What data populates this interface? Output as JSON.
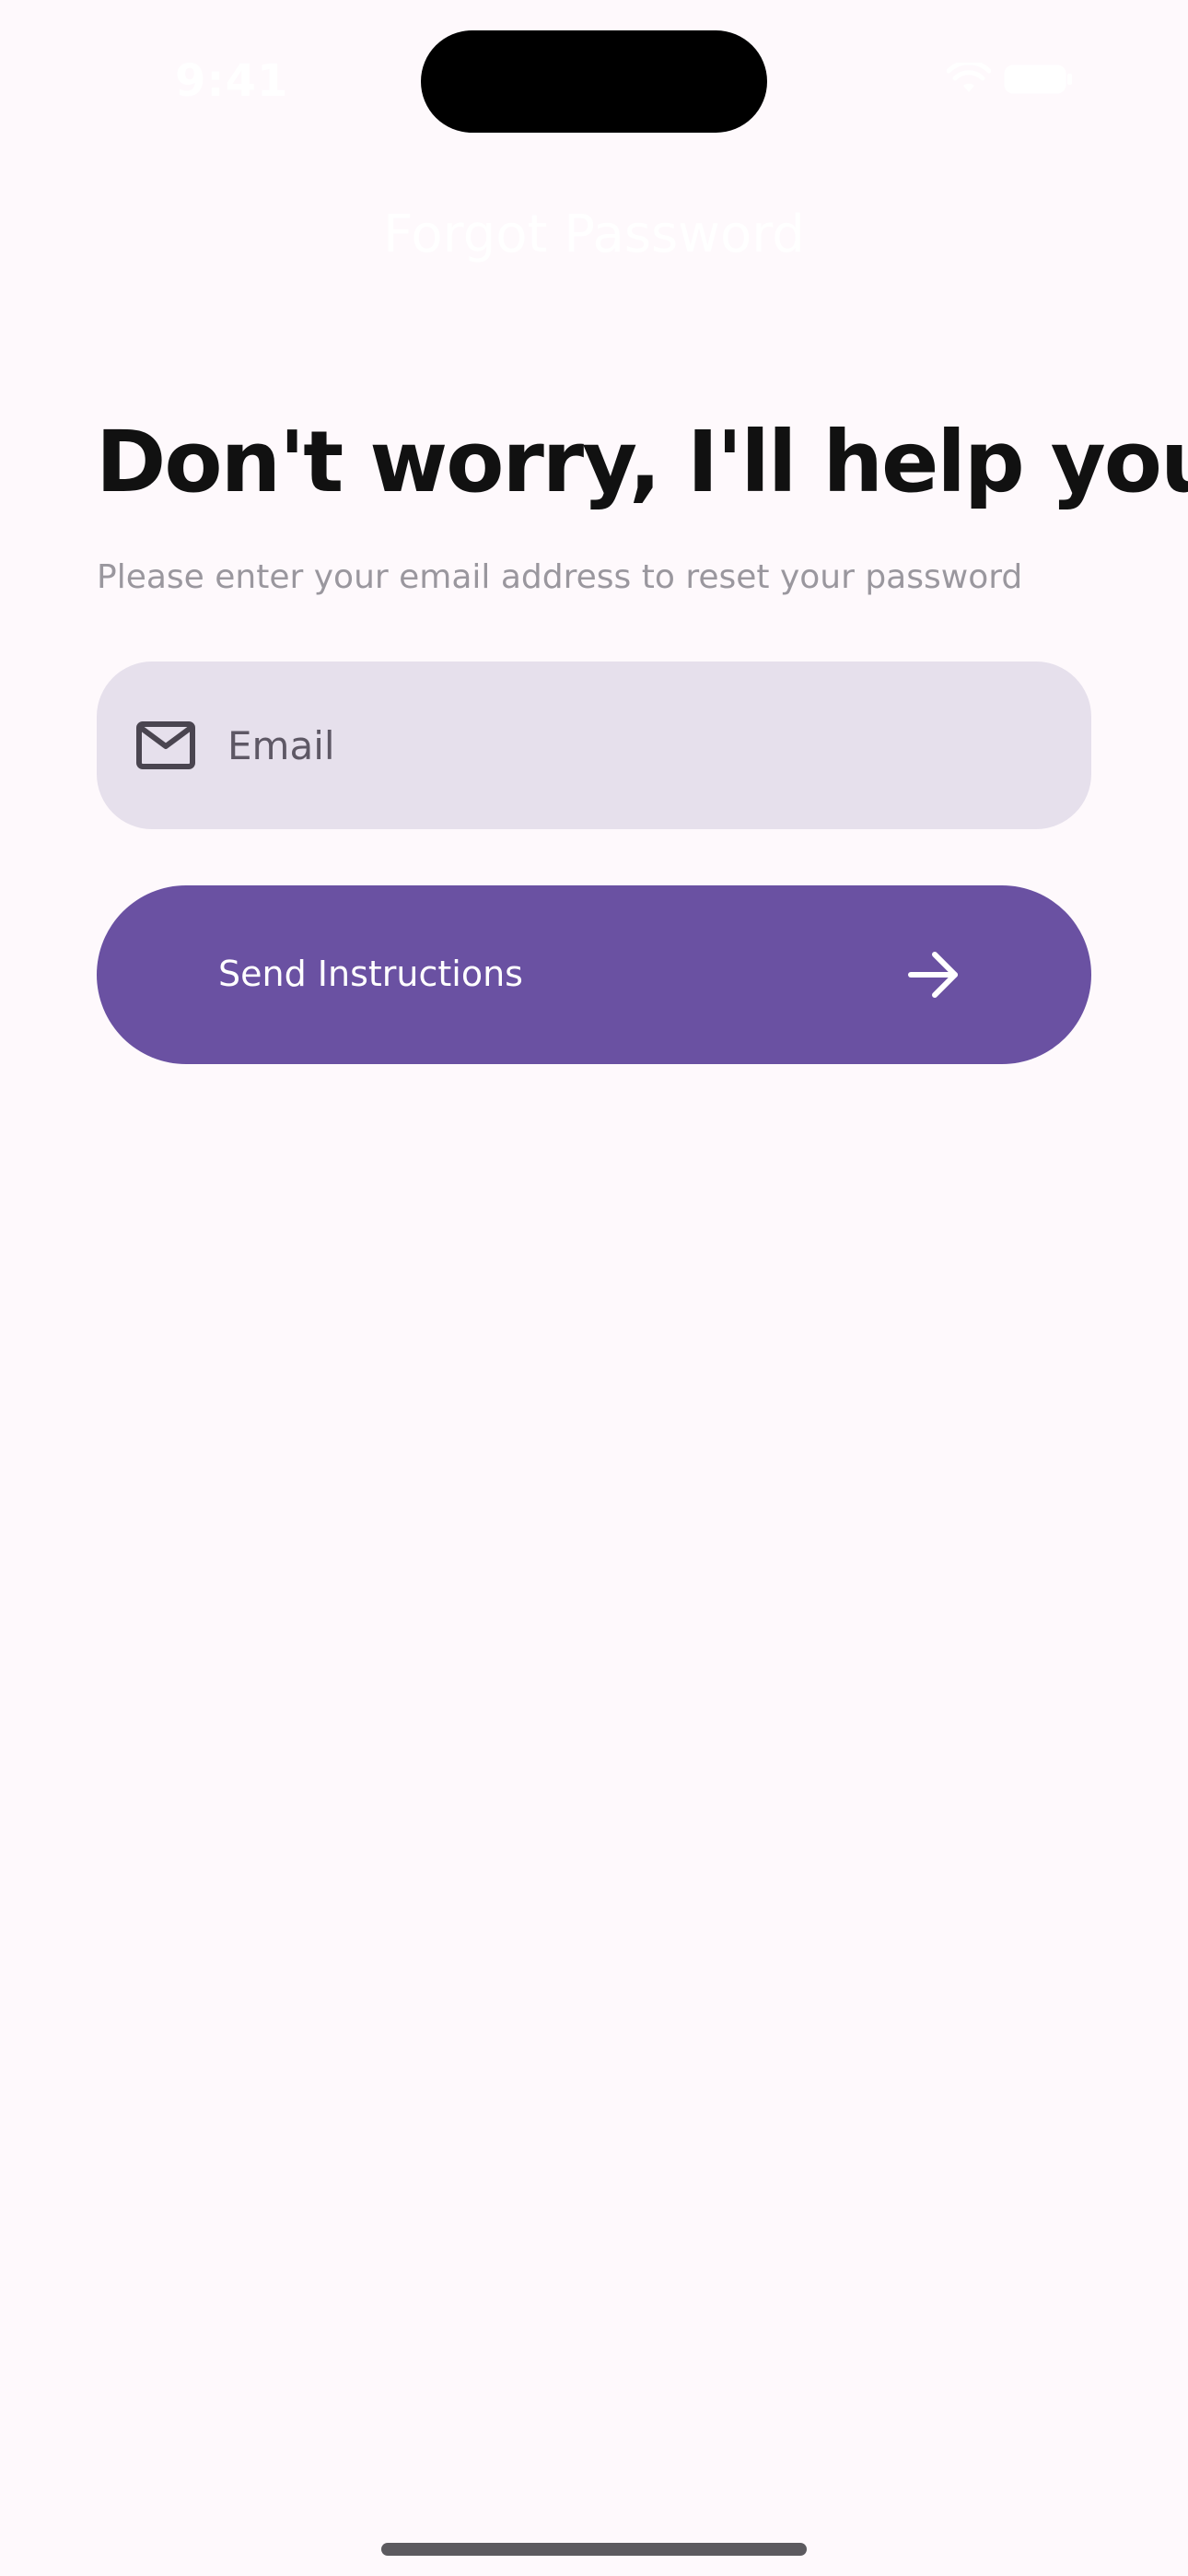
{
  "status_bar": {
    "time": "9:41",
    "icons": [
      "wifi-icon",
      "battery-icon"
    ]
  },
  "nav": {
    "title": "Forgot Password"
  },
  "content": {
    "headline": "Don't worry, I'll help you",
    "subtitle": "Please enter your email address to reset your password"
  },
  "email_field": {
    "placeholder": "Email",
    "value": "",
    "icon": "mail-icon"
  },
  "send_button": {
    "label": "Send Instructions",
    "icon": "arrow-right-icon"
  },
  "colors": {
    "background": "#FEF9FC",
    "accent": "#6A51A2",
    "field_background": "#E6E0EC",
    "subtitle": "#9A979E"
  }
}
